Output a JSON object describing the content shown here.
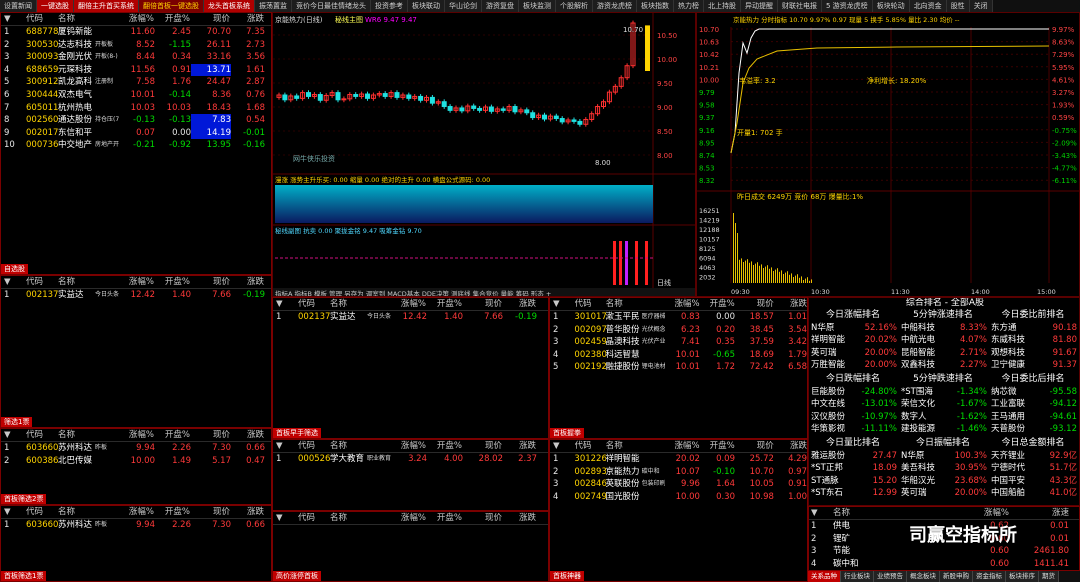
{
  "top_tabs": [
    {
      "label": "设置新闻",
      "style": ""
    },
    {
      "label": "一键选股",
      "style": "red"
    },
    {
      "label": "翻倍主升首买系统",
      "style": "red"
    },
    {
      "label": "翻倍首板一键选股",
      "style": "yel"
    },
    {
      "label": "龙头首板系统",
      "style": "red"
    },
    {
      "label": "振荡置监",
      "style": ""
    },
    {
      "label": "竞价今日最佳情绪龙头",
      "style": ""
    },
    {
      "label": "投资参考",
      "style": ""
    },
    {
      "label": "板块联动",
      "style": ""
    },
    {
      "label": "华山论剑",
      "style": ""
    },
    {
      "label": "游资复盘",
      "style": ""
    },
    {
      "label": "板块监测",
      "style": ""
    },
    {
      "label": "个股解析",
      "style": ""
    },
    {
      "label": "游资龙虎榜",
      "style": ""
    },
    {
      "label": "板块指数",
      "style": ""
    },
    {
      "label": "热力榜",
      "style": ""
    },
    {
      "label": "北上持股",
      "style": ""
    },
    {
      "label": "异动提醒",
      "style": ""
    },
    {
      "label": "财联社电报",
      "style": ""
    },
    {
      "label": "5 游资龙虎榜",
      "style": ""
    },
    {
      "label": "板块轮动",
      "style": ""
    },
    {
      "label": "北向资金",
      "style": ""
    },
    {
      "label": "股性",
      "style": ""
    },
    {
      "label": "关闭",
      "style": ""
    }
  ],
  "col_headers": {
    "code": "代码",
    "name": "名称",
    "chg": "涨幅%",
    "open": "开盘%",
    "price": "现价",
    "change": "涨跌"
  },
  "watch_list": [
    {
      "idx": "1",
      "code": "688778",
      "name": "厦钨新能",
      "chg": "11.60",
      "open": "2.45",
      "price": "70.70",
      "change": "7.35",
      "tag": "",
      "hl": ""
    },
    {
      "idx": "2",
      "code": "300530",
      "name": "达志科技",
      "chg": "8.52",
      "open": "-1.15",
      "price": "26.11",
      "change": "2.73",
      "tag": "开板板",
      "hl": ""
    },
    {
      "idx": "3",
      "code": "300093",
      "name": "金刚光伏",
      "chg": "8.44",
      "open": "0.34",
      "price": "33.16",
      "change": "3.56",
      "tag": "开板(8-)",
      "hl": ""
    },
    {
      "idx": "4",
      "code": "688659",
      "name": "元琛科技",
      "chg": "11.56",
      "open": "0.91",
      "price": "13.71",
      "change": "1.61",
      "tag": "",
      "hl": "blue"
    },
    {
      "idx": "5",
      "code": "300912",
      "name": "凯龙高科",
      "chg": "7.58",
      "open": "1.76",
      "price": "24.47",
      "change": "2.87",
      "tag": "注册制",
      "hl": ""
    },
    {
      "idx": "6",
      "code": "300444",
      "name": "双杰电气",
      "chg": "10.01",
      "open": "-0.14",
      "price": "8.36",
      "change": "0.76",
      "tag": "",
      "hl": ""
    },
    {
      "idx": "7",
      "code": "605011",
      "name": "杭州热电",
      "chg": "10.03",
      "open": "10.03",
      "price": "18.43",
      "change": "1.68",
      "tag": "",
      "hl": ""
    },
    {
      "idx": "8",
      "code": "002560",
      "name": "通达股份",
      "chg": "-0.13",
      "open": "-0.13",
      "price": "7.83",
      "change": "0.54",
      "tag": "持仓压(7)",
      "hl": "blue"
    },
    {
      "idx": "9",
      "code": "002017",
      "name": "东信和平",
      "chg": "0.07",
      "open": "0.00",
      "price": "14.19",
      "change": "-0.01",
      "tag": "",
      "hl": "blue"
    },
    {
      "idx": "10",
      "code": "000736",
      "name": "中交地产",
      "chg": "-0.21",
      "open": "-0.92",
      "price": "13.95",
      "change": "-0.16",
      "tag": "房地产开发",
      "hl": ""
    }
  ],
  "watch_title": "自选股",
  "left2": {
    "title": "筛选1票",
    "count": "1",
    "rows": [
      {
        "idx": "1",
        "code": "002137",
        "name": "实益达",
        "chg": "12.42",
        "open": "1.40",
        "price": "7.66",
        "change": "-0.19",
        "tag": "今日头条"
      }
    ]
  },
  "left3": {
    "title": "首板筛选2票",
    "count": "2",
    "rows": [
      {
        "idx": "1",
        "code": "603660",
        "name": "苏州科达",
        "chg": "9.94",
        "open": "2.26",
        "price": "7.30",
        "change": "0.66",
        "tag": "昨板"
      },
      {
        "idx": "2",
        "code": "600386",
        "name": "北巴传媒",
        "chg": "10.00",
        "open": "1.49",
        "price": "5.17",
        "change": "0.47",
        "tag": ""
      }
    ]
  },
  "left4": {
    "title": "首板筛选1票",
    "count": "1",
    "rows": [
      {
        "idx": "1",
        "code": "603660",
        "name": "苏州科达",
        "chg": "9.94",
        "open": "2.26",
        "price": "7.30",
        "change": "0.66",
        "tag": "昨板"
      }
    ]
  },
  "mid2": {
    "title": "首板早手筛选",
    "count": "1",
    "rows": [
      {
        "idx": "1",
        "code": "002137",
        "name": "实益达",
        "chg": "12.42",
        "open": "1.40",
        "price": "7.66",
        "change": "-0.19",
        "tag": "今日头条"
      }
    ]
  },
  "mid3": {
    "title": "首板接力",
    "count": "1",
    "rows": [
      {
        "idx": "1",
        "code": "000526",
        "name": "学大教育",
        "chg": "3.24",
        "open": "4.00",
        "price": "28.02",
        "change": "2.37",
        "tag": "职业教育"
      }
    ]
  },
  "mid4": {
    "title": "高价涨停首板",
    "count": "0",
    "rows": []
  },
  "right2": {
    "title": "首板握拳",
    "count": "5",
    "rows": [
      {
        "idx": "1",
        "code": "301017",
        "name": "漱玉平民",
        "chg": "0.83",
        "open": "0.00",
        "price": "18.57",
        "change": "1.01",
        "tag": "医疗器械"
      },
      {
        "idx": "2",
        "code": "002097",
        "name": "普华股份",
        "chg": "6.23",
        "open": "0.20",
        "price": "38.45",
        "change": "3.54",
        "tag": "光伏概念"
      },
      {
        "idx": "3",
        "code": "002459",
        "name": "晶澳科技",
        "chg": "7.41",
        "open": "0.35",
        "price": "37.59",
        "change": "3.42",
        "tag": "光伏产业链"
      },
      {
        "idx": "4",
        "code": "002380",
        "name": "科远智慧",
        "chg": "10.01",
        "open": "-0.65",
        "price": "18.69",
        "change": "1.79",
        "tag": ""
      },
      {
        "idx": "5",
        "code": "002192",
        "name": "融捷股份",
        "chg": "10.01",
        "open": "1.72",
        "price": "72.42",
        "change": "6.58",
        "tag": "锂电池材料"
      }
    ]
  },
  "right3": {
    "title": "首板神器",
    "count": "4",
    "rows": [
      {
        "idx": "1",
        "code": "301226",
        "name": "祥明智能",
        "chg": "20.02",
        "open": "0.09",
        "price": "25.72",
        "change": "4.29",
        "tag": ""
      },
      {
        "idx": "2",
        "code": "002893",
        "name": "京能热力",
        "chg": "10.07",
        "open": "-0.10",
        "price": "10.70",
        "change": "0.97",
        "tag": "碳中和"
      },
      {
        "idx": "3",
        "code": "002846",
        "name": "英联股份",
        "chg": "9.96",
        "open": "1.64",
        "price": "10.05",
        "change": "0.91",
        "tag": "包装印刷"
      },
      {
        "idx": "4",
        "code": "002749",
        "name": "国光股份",
        "chg": "10.00",
        "open": "0.30",
        "price": "10.98",
        "change": "1.00",
        "tag": ""
      }
    ]
  },
  "kline": {
    "title": "京能热力(日线)",
    "indicator": "秘线主图",
    "extra": "WR6 9.47 9.47",
    "price_labels": [
      "10.50",
      "10.00",
      "9.50",
      "9.00",
      "8.50",
      "8.00"
    ],
    "high": "10.70",
    "low": "8.00",
    "watermark": "网牛侠乐投资",
    "sub1": "漫涨 涨势主升乐买: 0.00 缩量 0.00 绝对的主升 0.00 横盘公式源码: 0.00",
    "sub2": "秘线副图 抗卖 0.00 聚拢金铭 9.47 吸筹金钻 9.70",
    "bottom_tabs": "指标A 指标B 模板 管理 另存为 调室到 MACD基本 DDE决策 测底线 集合竞价 量能 筹码 形态 +",
    "right_label": "日线"
  },
  "intraday": {
    "title": "京能热力 分时指标 10.70 9.97% 0.97 现量 5 换手 5.85% 量比 2.30 均价 --",
    "pct_left": [
      "10.70",
      "10.63",
      "10.42",
      "10.21",
      "10.00",
      "9.79",
      "9.58",
      "9.37",
      "9.16",
      "8.95",
      "8.74",
      "8.53",
      "8.32"
    ],
    "pct_right": [
      "9.97%",
      "8.63%",
      "7.29%",
      "5.95%",
      "4.61%",
      "3.27%",
      "1.93%",
      "0.59%",
      "-0.75%",
      "-2.09%",
      "-3.43%",
      "-4.77%",
      "-6.11%"
    ],
    "label_chg": "韦溢率: 3.2",
    "label_growth": "净利增长: 18.20%",
    "open_amt": "开量1: 702 手",
    "vol_text": "昨日成交 6249万 竞价 68万 爆量比:1%",
    "vol_labels": [
      "16251",
      "14219",
      "12188",
      "10157",
      "8125",
      "6094",
      "4063",
      "2032"
    ],
    "time_labels": [
      "09:30",
      "10:30",
      "11:30",
      "14:00",
      "15:00"
    ]
  },
  "rank": {
    "title": "综合排名 - 全部A股",
    "b1": [
      {
        "t": "今日涨幅排名",
        "rows": [
          [
            "N华原",
            "52.16%"
          ],
          [
            "祥明智能",
            "20.02%"
          ],
          [
            "英可瑞",
            "20.00%"
          ],
          [
            "万胜智能",
            "20.00%"
          ]
        ]
      },
      {
        "t": "5分钟涨速排名",
        "rows": [
          [
            "中船科技",
            "8.33%"
          ],
          [
            "中航光电",
            "4.07%"
          ],
          [
            "昆船智能",
            "2.71%"
          ],
          [
            "双鑫科技",
            "2.27%"
          ]
        ]
      },
      {
        "t": "今日委比前排名",
        "rows": [
          [
            "东方通",
            "90.18"
          ],
          [
            "东威科技",
            "81.80"
          ],
          [
            "观想科技",
            "91.67"
          ],
          [
            "卫宁健康",
            "91.37"
          ]
        ]
      }
    ],
    "b2": [
      {
        "t": "今日跌幅排名",
        "rows": [
          [
            "巨能股份",
            "-24.80%"
          ],
          [
            "中文在线",
            "-13.01%"
          ],
          [
            "汉仪股份",
            "-10.97%"
          ],
          [
            "华策影视",
            "-11.11%"
          ]
        ]
      },
      {
        "t": "5分钟跌速排名",
        "rows": [
          [
            "*ST围海",
            "-1.34%"
          ],
          [
            "荣信文化",
            "-1.67%"
          ],
          [
            "数字人",
            "-1.62%"
          ],
          [
            "建投能源",
            "-1.46%"
          ]
        ]
      },
      {
        "t": "今日委比后排名",
        "rows": [
          [
            "纳芯微",
            "-95.58"
          ],
          [
            "工业富联",
            "-94.12"
          ],
          [
            "王马通用",
            "-94.61"
          ],
          [
            "天普股份",
            "-93.12"
          ]
        ]
      }
    ],
    "b3": [
      {
        "t": "今日量比排名",
        "rows": [
          [
            "雅运股份",
            "27.47"
          ],
          [
            "*ST正邦",
            "18.09"
          ],
          [
            "ST通脉",
            "15.20"
          ],
          [
            "*ST东石",
            "12.99"
          ]
        ]
      },
      {
        "t": "今日振幅排名",
        "rows": [
          [
            "N华原",
            "100.3%"
          ],
          [
            "美吾科技",
            "30.95%"
          ],
          [
            "华船汉光",
            "23.68%"
          ],
          [
            "英可瑞",
            "20.00%"
          ]
        ]
      },
      {
        "t": "今日总金额排名",
        "rows": [
          [
            "天齐锂业",
            "92.9亿"
          ],
          [
            "宁德时代",
            "51.7亿"
          ],
          [
            "中国平安",
            "43.3亿"
          ],
          [
            "中国船舶",
            "41.0亿"
          ]
        ]
      }
    ]
  },
  "sector": {
    "headers": [
      "名称",
      "涨幅%",
      "涨速"
    ],
    "rows": [
      [
        "供电",
        "0.62",
        "0.01"
      ],
      [
        "锂矿",
        "0.60",
        "0.01"
      ],
      [
        "节能",
        "0.60",
        "2461.80"
      ],
      [
        "碳中和",
        "0.60",
        "1411.41"
      ]
    ],
    "watermark": "司赢空指标所"
  },
  "bottom_tabs": [
    "关系品种",
    "行业板块",
    "业绩预告",
    "概念板块",
    "新股申购",
    "资金指标",
    "板块排序",
    "期货"
  ]
}
